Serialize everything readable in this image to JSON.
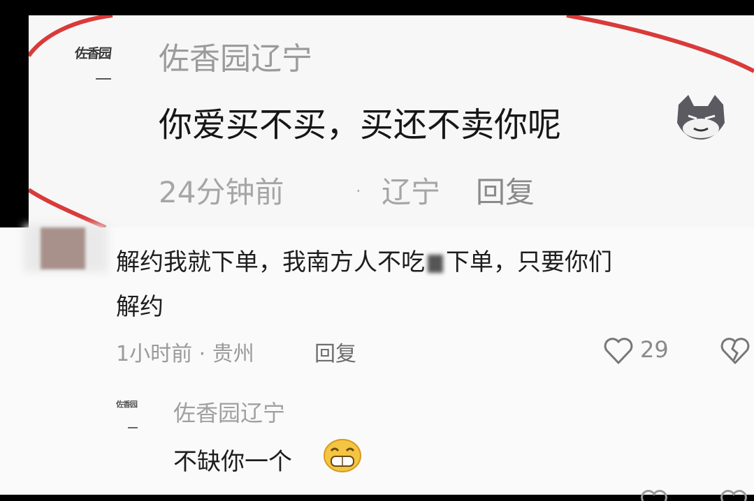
{
  "zoom_card": {
    "logo_text": "佐香园",
    "username": "佐香园辽宁",
    "comment": "你爱买不买，买还不卖你呢",
    "time": "24分钟前",
    "location": "辽宁",
    "reply_label": "回复"
  },
  "comment": {
    "text_line1": "解约我就下单，我南方人不吃",
    "text_line1b": "下单，只要你们",
    "text_line2": "解约",
    "time_location": "1小时前 · 贵州",
    "reply_label": "回复",
    "like_count": "29"
  },
  "reply": {
    "logo_text": "佐香园",
    "username": "佐香园辽宁",
    "text": "不缺你一个"
  },
  "colors": {
    "red_mark": "#d93a3a",
    "text_primary": "#1d1d1d",
    "text_secondary": "#9a9a9a"
  }
}
